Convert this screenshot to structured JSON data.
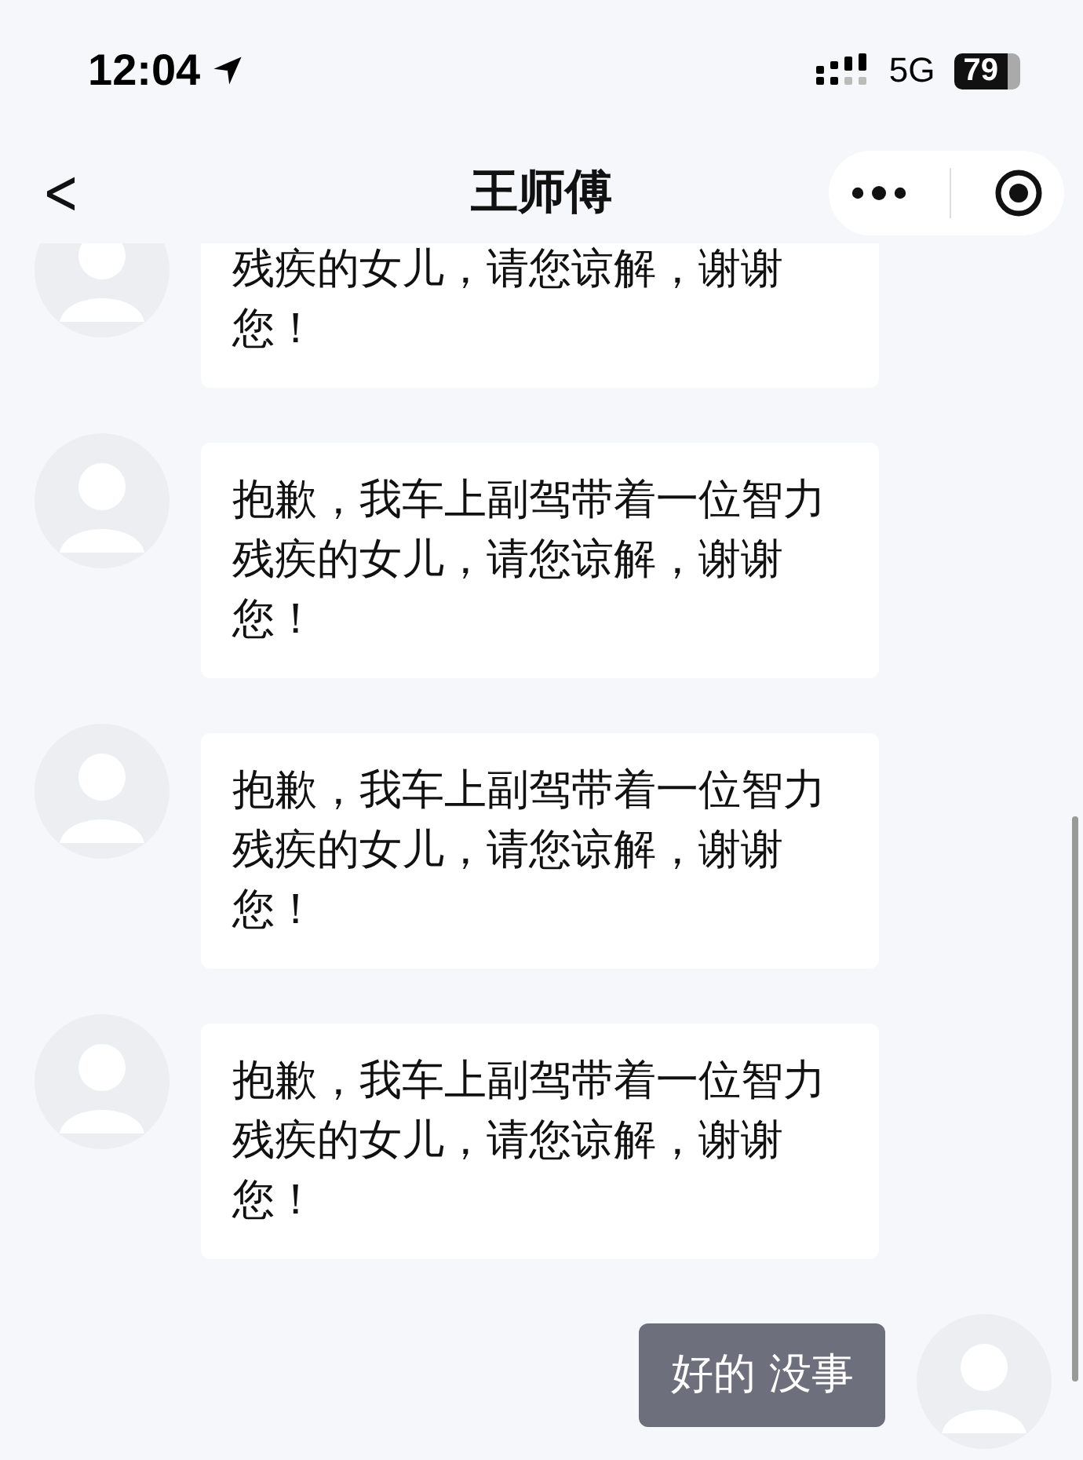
{
  "status_bar": {
    "time": "12:04",
    "network": "5G",
    "battery": "79"
  },
  "nav_bar": {
    "back": "<",
    "title": "王师傅"
  },
  "messages": [
    {
      "kind": "incoming",
      "text": "残疾的女儿，请您谅解，谢谢您！"
    },
    {
      "kind": "incoming",
      "text": "抱歉，我车上副驾带着一位智力残疾的女儿，请您谅解，谢谢您！"
    },
    {
      "kind": "incoming",
      "text": "抱歉，我车上副驾带着一位智力残疾的女儿，请您谅解，谢谢您！"
    },
    {
      "kind": "incoming",
      "text": "抱歉，我车上副驾带着一位智力残疾的女儿，请您谅解，谢谢您！"
    },
    {
      "kind": "outgoing",
      "text": "好的 没事"
    }
  ]
}
